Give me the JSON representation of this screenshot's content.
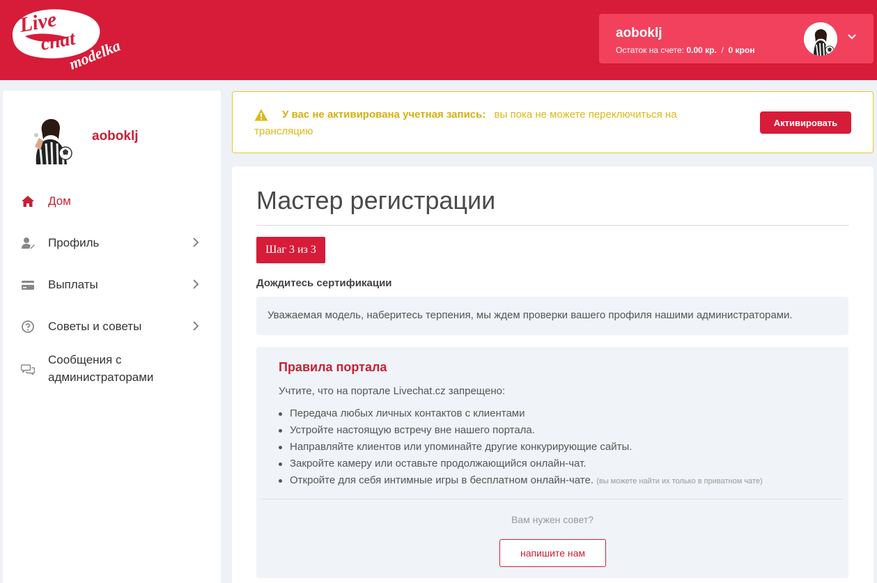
{
  "brand": {
    "logo_line1": "Live",
    "logo_line2": "chat",
    "logo_line3": "modelka",
    "primary_color": "#d61c39",
    "accent_color": "#f2415c",
    "warning_color": "#e4cb2c"
  },
  "account": {
    "username": "aoboklj",
    "balance_label": "Остаток на счете:",
    "balance_value": "0.00 кр.",
    "separator": "/",
    "balance_czk": "0 крон"
  },
  "sidebar": {
    "username": "aoboklj",
    "items": [
      {
        "label": "Дом",
        "icon": "home-icon",
        "active": true
      },
      {
        "label": "Профиль",
        "icon": "user-edit-icon",
        "has_submenu": true
      },
      {
        "label": "Выплаты",
        "icon": "credit-card-icon",
        "has_submenu": true
      },
      {
        "label": "Советы и советы",
        "icon": "question-circle-icon",
        "has_submenu": true
      },
      {
        "label": "Сообщения с",
        "label_line2": "администраторами",
        "icon": "chat-bubbles-icon"
      }
    ]
  },
  "alert": {
    "title": "У вас не активирована учетная запись:",
    "message": "вы пока не можете переключиться на трансляцию",
    "button_label": "Активировать"
  },
  "wizard": {
    "title": "Мастер регистрации",
    "step_label": "Шаг 3 из 3",
    "section_title": "Дождитесь сертификации",
    "section_text": "Уважаемая модель, наберитесь терпения, мы ждем проверки вашего профиля нашими администраторами."
  },
  "rules": {
    "title": "Правила портала",
    "intro": "Учтите, что на портале Livechat.cz запрещено:",
    "items": [
      "Передача любых личных контактов с клиентами",
      "Устройте настоящую встречу вне нашего портала.",
      "Направляйте клиентов или упоминайте другие конкурирующие сайты.",
      "Закройте камеру или оставьте продолжающийся онлайн-чат.",
      "Откройте для себя интимные игры в бесплатном онлайн-чате."
    ],
    "last_item_note": "(вы можете найти их только в приватном чате)",
    "advice_question": "Вам нужен совет?",
    "write_button": "напишите нам"
  }
}
